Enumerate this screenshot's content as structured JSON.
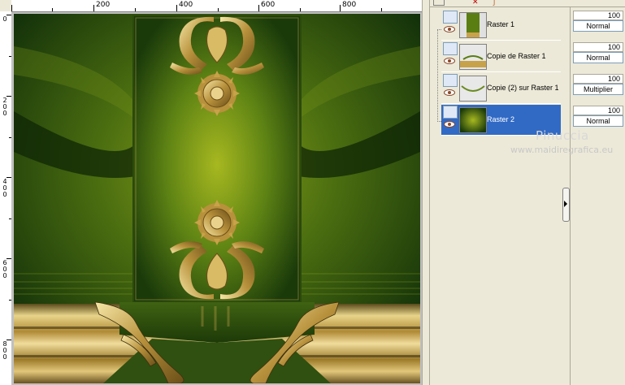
{
  "ruler": {
    "top_labels": [
      "200",
      "400",
      "600",
      "800"
    ],
    "left_labels": [
      "0",
      "200",
      "400",
      "600",
      "800"
    ]
  },
  "layers": [
    {
      "name": "Raster 1",
      "opacity": "100",
      "blend": "Normal",
      "selected": false
    },
    {
      "name": "Copie de Raster 1",
      "opacity": "100",
      "blend": "Normal",
      "selected": false
    },
    {
      "name": "Copie (2) sur Raster 1",
      "opacity": "100",
      "blend": "Multiplier",
      "selected": false
    },
    {
      "name": "Raster 2",
      "opacity": "100",
      "blend": "Normal",
      "selected": true
    }
  ],
  "watermark": {
    "name": "Pinuccia",
    "url": "www.maidiregrafica.eu"
  },
  "colors": {
    "selection": "#316ac5",
    "panel_bg": "#ece9d8",
    "green_dark": "#1a3a08",
    "green_light": "#9aae1e",
    "gold": "#c8a24a"
  }
}
